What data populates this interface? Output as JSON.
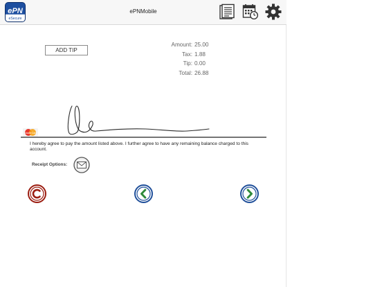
{
  "header": {
    "title": "ePNMobile",
    "logo_text": "ePN",
    "logo_subtext": "eSecure",
    "icons": [
      "receipt-list-icon",
      "calendar-clock-icon",
      "gear-icon"
    ]
  },
  "tip": {
    "button_label": "ADD TIP"
  },
  "totals": {
    "rows": [
      {
        "label": "Amount:",
        "value": "25.00"
      },
      {
        "label": "Tax:",
        "value": "1.88"
      },
      {
        "label": "Tip:",
        "value": "0.00"
      },
      {
        "label": "Total:",
        "value": "26.88"
      }
    ]
  },
  "signature": {
    "card_brand": "MasterCard",
    "agreement_text": "I hereby agree to pay the amount listed above. I further agree to have any remaining balance charged to this account."
  },
  "receipt": {
    "label": "Receipt Options:",
    "email_icon": "envelope-icon"
  },
  "nav": {
    "cancel_icon": "cancel-c-icon",
    "back_icon": "chevron-left-icon",
    "forward_icon": "chevron-right-icon"
  },
  "colors": {
    "logo_blue": "#1d4fa0",
    "cancel_red": "#9b1c10",
    "nav_blue": "#1f4f9a",
    "nav_green": "#2f8a3a"
  }
}
